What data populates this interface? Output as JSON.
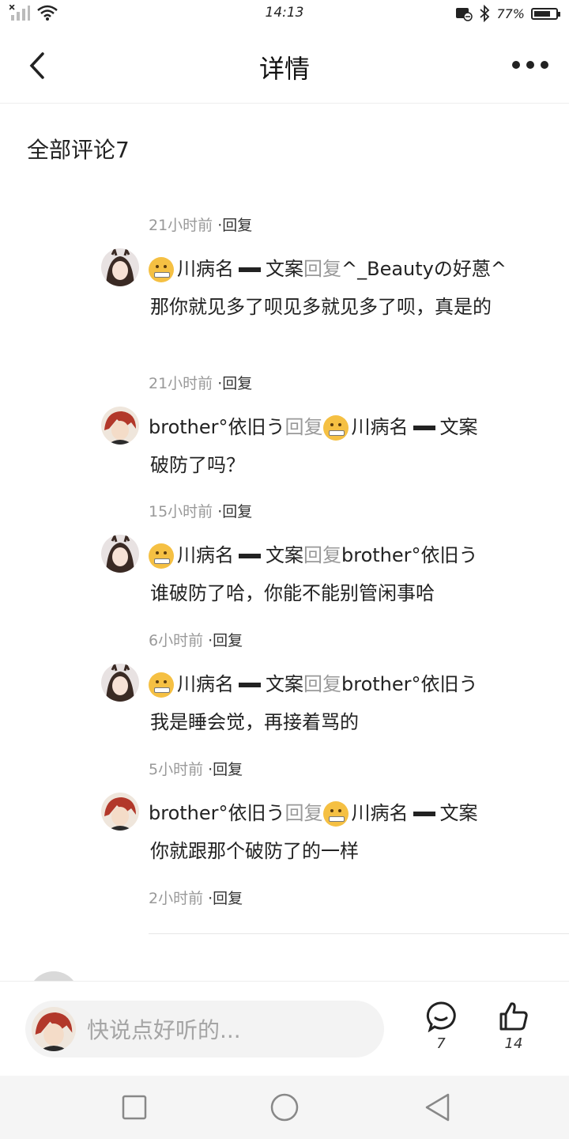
{
  "status": {
    "time": "14:13",
    "battery": "77%",
    "battery_level": 0.77
  },
  "header": {
    "title": "详情"
  },
  "section_title": "全部评论7",
  "first_time": {
    "time": "21小时前",
    "reply": "·回复"
  },
  "comments": [
    {
      "author": "川病名",
      "author_suffix": "文案",
      "reply_word": "回复",
      "target": "^_Beautyの好蒽^",
      "text": "那你就见多了呗见多就见多了呗，真是的",
      "time": "21小时前",
      "reply": "·回复"
    },
    {
      "author": "brother°依旧う",
      "reply_word": "回复",
      "target": "川病名",
      "target_suffix": "文案",
      "text": "破防了吗？",
      "time": "15小时前",
      "reply": "·回复"
    },
    {
      "author": "川病名",
      "author_suffix": "文案",
      "reply_word": "回复",
      "target": "brother°依旧う",
      "text": "谁破防了哈，你能不能别管闲事哈",
      "time": "6小时前",
      "reply": "·回复"
    },
    {
      "author": "川病名",
      "author_suffix": "文案",
      "reply_word": "回复",
      "target": "brother°依旧う",
      "text": "我是睡会觉，再接着骂的",
      "time": "5小时前",
      "reply": "·回复"
    },
    {
      "author": "brother°依旧う",
      "reply_word": "回复",
      "target": "川病名",
      "target_suffix": "文案",
      "text": "你就跟那个破防了的一样",
      "time": "2小时前",
      "reply": "·回复"
    }
  ],
  "bottom": {
    "placeholder": "快说点好听的...",
    "comment_count": "7",
    "like_count": "14"
  },
  "icons": {
    "back": "chevron-left-icon",
    "more": "more-dots-icon",
    "comment": "comment-bubble-icon",
    "like": "thumbs-up-icon",
    "emoji": "zipper-mouth-emoji"
  }
}
